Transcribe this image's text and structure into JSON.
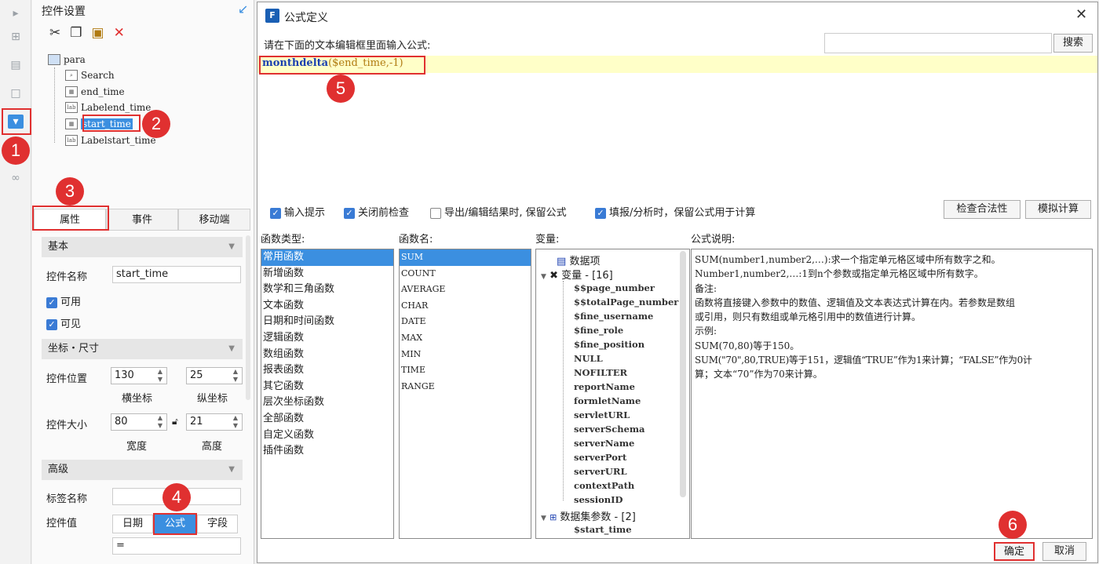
{
  "left_panel": {
    "title": "控件设置",
    "tree": {
      "root": "para",
      "items": [
        "Search",
        "end_time",
        "Labelend_time",
        "start_time",
        "Labelstart_time"
      ]
    },
    "tabs": [
      "属性",
      "事件",
      "移动端"
    ],
    "basic": {
      "section": "基本",
      "name_label": "控件名称",
      "name_value": "start_time",
      "enabled_label": "可用",
      "visible_label": "可见"
    },
    "coords": {
      "section": "坐标・尺寸",
      "pos_label": "控件位置",
      "x_value": "130",
      "y_value": "25",
      "x_caption": "横坐标",
      "y_caption": "纵坐标",
      "size_label": "控件大小",
      "w_value": "80",
      "h_value": "21",
      "w_caption": "宽度",
      "h_caption": "高度"
    },
    "advanced": {
      "section": "高级",
      "tag_label": "标签名称",
      "tag_value": "",
      "value_label": "控件值",
      "modes": [
        "日期",
        "公式",
        "字段"
      ],
      "formula_value": "="
    }
  },
  "dialog": {
    "title": "公式定义",
    "prompt": "请在下面的文本编辑框里面输入公式:",
    "search_button": "搜索",
    "formula": {
      "func": "monthdelta",
      "open": "(",
      "arg": "$end_time",
      "rest": ",-1)"
    },
    "options": [
      {
        "label": "输入提示",
        "checked": true
      },
      {
        "label": "关闭前检查",
        "checked": true
      },
      {
        "label": "导出/编辑结果时, 保留公式",
        "checked": false
      },
      {
        "label": "填报/分析时，保留公式用于计算",
        "checked": true
      }
    ],
    "check_button": "检查合法性",
    "simulate_button": "模拟计算",
    "headers": {
      "types": "函数类型:",
      "names": "函数名:",
      "vars": "变量:",
      "desc": "公式说明:"
    },
    "function_types": [
      "常用函数",
      "新增函数",
      "数学和三角函数",
      "文本函数",
      "日期和时间函数",
      "逻辑函数",
      "数组函数",
      "报表函数",
      "其它函数",
      "层次坐标函数",
      "全部函数",
      "自定义函数",
      "插件函数"
    ],
    "function_names": [
      "SUM",
      "COUNT",
      "AVERAGE",
      "CHAR",
      "DATE",
      "MAX",
      "MIN",
      "TIME",
      "RANGE"
    ],
    "variables": {
      "data_items": "数据项",
      "var_group": "变量 - [16]",
      "vars": [
        "$$page_number",
        "$$totalPage_number",
        "$fine_username",
        "$fine_role",
        "$fine_position",
        "NULL",
        "NOFILTER",
        "reportName",
        "formletName",
        "servletURL",
        "serverSchema",
        "serverName",
        "serverPort",
        "serverURL",
        "contextPath",
        "sessionID"
      ],
      "dataset_group": "数据集参数 - [2]",
      "dataset_vars": [
        "$start_time"
      ]
    },
    "description": [
      "SUM(number1,number2,…):求一个指定单元格区域中所有数字之和。",
      "Number1,number2,…:1到n个参数或指定单元格区域中所有数字。",
      "备注:",
      "函数将直接键入参数中的数值、逻辑值及文本表达式计算在内。若参数是数组",
      "或引用，则只有数组或单元格引用中的数值进行计算。",
      "示例:",
      "SUM(70,80)等于150。",
      "SUM(\"70\",80,TRUE)等于151，逻辑值“TRUE”作为1来计算；“FALSE”作为0计",
      "算；文本“70”作为70来计算。"
    ],
    "ok_button": "确定",
    "cancel_button": "取消"
  },
  "annotations": [
    "1",
    "2",
    "3",
    "4",
    "5",
    "6"
  ],
  "colors": {
    "accent": "#3b8fe0",
    "annotation": "#e03030",
    "formula_bg": "#ffffc8",
    "formula_func": "#1a3fb0",
    "formula_var": "#b07a10"
  }
}
